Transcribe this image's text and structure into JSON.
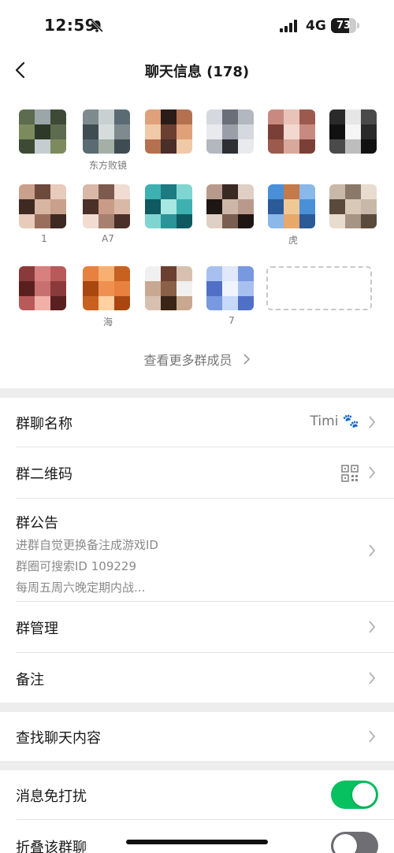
{
  "status_bar": {
    "time": "12:59",
    "network": "4G",
    "battery": "73",
    "battery_level": 0.73
  },
  "nav": {
    "title": "聊天信息 (178)"
  },
  "members": [
    {
      "name": "",
      "colors": [
        "#5d6b4f",
        "#9aa6a8",
        "#3e4a35",
        "#c5cdd0",
        "#7c8a5e",
        "#2d3a28"
      ]
    },
    {
      "name": "东方败镜",
      "colors": [
        "#7f8a8e",
        "#c9d0d2",
        "#5a6b73",
        "#a4b0a6",
        "#3f4c52",
        "#d6dcdc"
      ]
    },
    {
      "name": "",
      "colors": [
        "#e0a07a",
        "#2a1c18",
        "#b5714f",
        "#4a2e28",
        "#f0c9a8",
        "#6b4032"
      ]
    },
    {
      "name": "",
      "colors": [
        "#d5d8de",
        "#6a6e78",
        "#b3b7c0",
        "#2d2f35",
        "#e8eaee",
        "#9a9ea8"
      ]
    },
    {
      "name": "",
      "colors": [
        "#c88a80",
        "#e9c3b8",
        "#9c5a4f",
        "#d9a89c",
        "#7a3f36",
        "#f2d8cf"
      ]
    },
    {
      "name": "",
      "colors": [
        "#2a2a2a",
        "#e6e6e6",
        "#4a4a4a",
        "#bdbdbd",
        "#111111",
        "#f5f5f5"
      ]
    },
    {
      "name": "1",
      "colors": [
        "#c9a08c",
        "#6e4a3c",
        "#e8cbbb",
        "#9a6e5c",
        "#3e2a22",
        "#d8b4a2"
      ]
    },
    {
      "name": "A7",
      "colors": [
        "#d9b8a8",
        "#7c5a4e",
        "#f1dcd2",
        "#a88070",
        "#4a3028",
        "#c99c88"
      ]
    },
    {
      "name": "",
      "colors": [
        "#3fb0b0",
        "#1c7a80",
        "#7fd6d0",
        "#2a9498",
        "#0f5a60",
        "#a8e8e2"
      ]
    },
    {
      "name": "",
      "colors": [
        "#b89a8c",
        "#3a2a24",
        "#e0cfc4",
        "#7a5e50",
        "#1e1612",
        "#cdb6a8"
      ]
    },
    {
      "name": "虎",
      "colors": [
        "#4a90d8",
        "#c47a4a",
        "#8ab8e8",
        "#e8a86a",
        "#2a5a98",
        "#f0c896"
      ]
    },
    {
      "name": "",
      "colors": [
        "#c8b8a8",
        "#8a7868",
        "#e8dccf",
        "#a89484",
        "#5a4a3c",
        "#d8c8b8"
      ]
    },
    {
      "name": "",
      "colors": [
        "#8a3a3a",
        "#d88080",
        "#b85a5a",
        "#f0b0a8",
        "#5a2020",
        "#c87070"
      ]
    },
    {
      "name": "海",
      "colors": [
        "#e88040",
        "#f8b070",
        "#c86020",
        "#ffd0a0",
        "#a84810",
        "#f09050"
      ]
    },
    {
      "name": "",
      "colors": [
        "#f0f0f0",
        "#6a4030",
        "#d8c0b0",
        "#3a2418",
        "#c8a890",
        "#8a6048"
      ]
    },
    {
      "name": "7",
      "colors": [
        "#a8c0f0",
        "#e0e8fa",
        "#7898e0",
        "#c8d8f8",
        "#5070c8",
        "#f0f4fe"
      ]
    }
  ],
  "more_members": "查看更多群成员",
  "cells": {
    "group_name_label": "群聊名称",
    "group_name_value": "Timi 🐾",
    "qr_label": "群二维码",
    "notice_label": "群公告",
    "notice_lines": [
      "进群自觉更换备注成游戏ID",
      "群圈可搜索ID 109229",
      "每周五周六晚定期内战..."
    ],
    "manage_label": "群管理",
    "remark_label": "备注",
    "search_label": "查找聊天内容",
    "mute_label": "消息免打扰",
    "mute_on": true,
    "fold_label": "折叠该群聊",
    "fold_on": false
  },
  "colors": {
    "toggle_on": "#07c160",
    "toggle_off": "#6e6e73",
    "page_bg": "#ededed"
  }
}
